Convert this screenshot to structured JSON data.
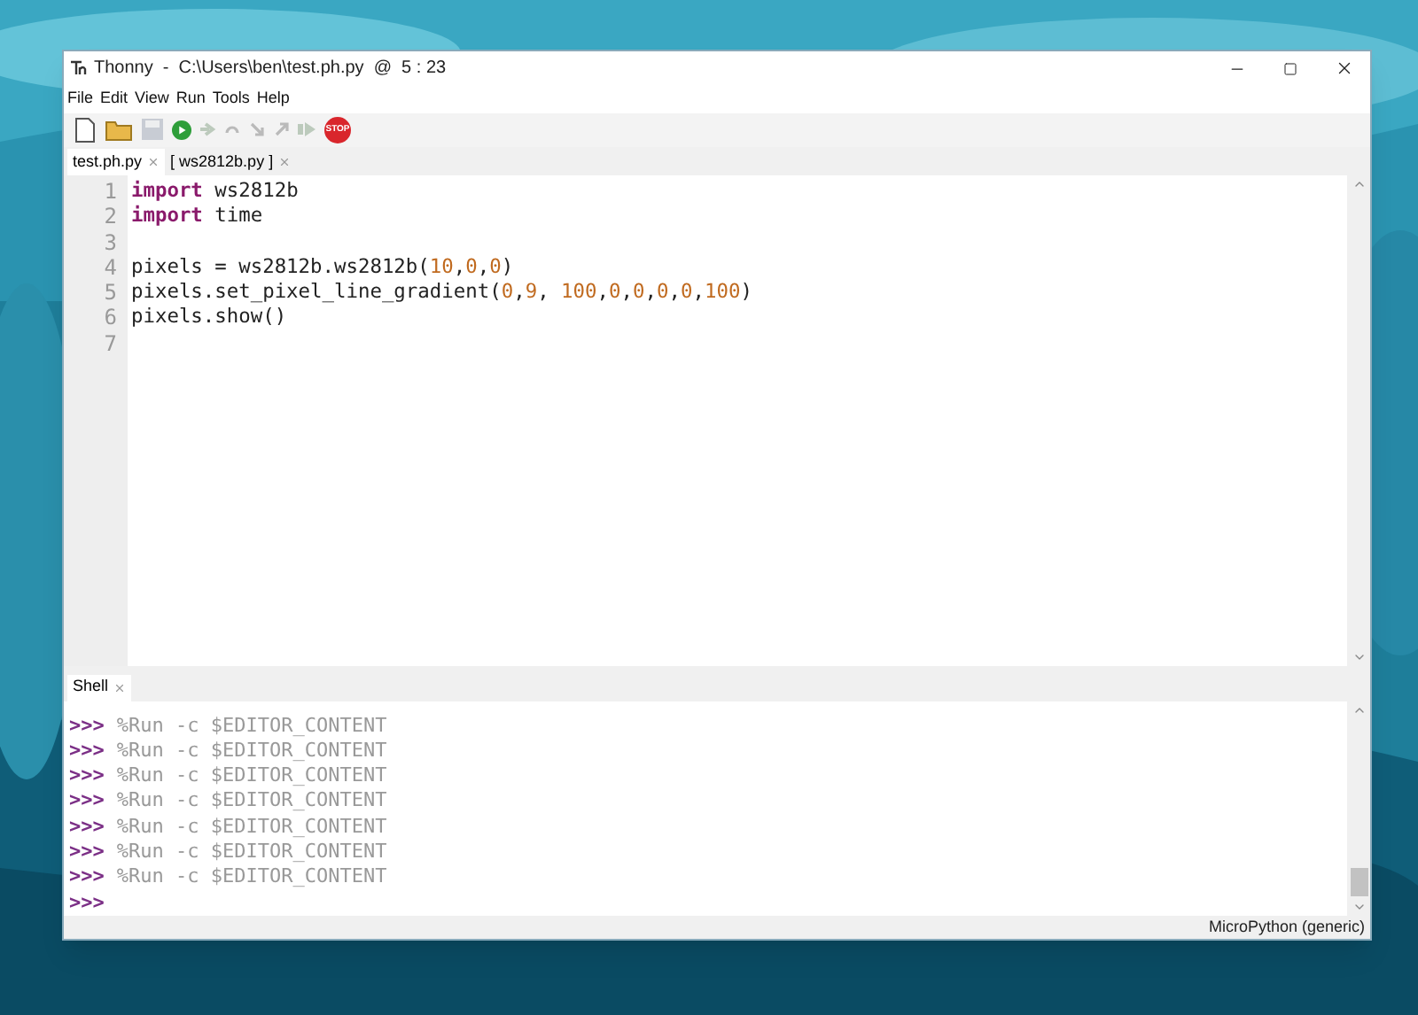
{
  "window": {
    "title": "Thonny  -  C:\\Users\\ben\\test.ph.py  @  5 : 23"
  },
  "menu": [
    "File",
    "Edit",
    "View",
    "Run",
    "Tools",
    "Help"
  ],
  "toolbar": [
    {
      "kind": "new",
      "disabled": false
    },
    {
      "kind": "open",
      "disabled": false
    },
    {
      "kind": "save",
      "disabled": true
    },
    {
      "kind": "run",
      "disabled": false
    },
    {
      "kind": "debug",
      "disabled": true
    },
    {
      "kind": "step-over",
      "disabled": true
    },
    {
      "kind": "step-into",
      "disabled": true
    },
    {
      "kind": "step-out",
      "disabled": true
    },
    {
      "kind": "resume",
      "disabled": true
    },
    {
      "kind": "stop",
      "disabled": false,
      "label": "STOP"
    }
  ],
  "editor_tabs": [
    {
      "label": "test.ph.py",
      "selected": true
    },
    {
      "label": "[ ws2812b.py ]",
      "selected": false
    }
  ],
  "editor": {
    "lines": [
      {
        "number": "1",
        "tokens": [
          {
            "kind": "keyword",
            "text": "import"
          },
          {
            "kind": "plain",
            "text": " ws2812b"
          }
        ]
      },
      {
        "number": "2",
        "tokens": [
          {
            "kind": "keyword",
            "text": "import"
          },
          {
            "kind": "plain",
            "text": " time"
          }
        ]
      },
      {
        "number": "3"
      },
      {
        "number": "4",
        "tokens": [
          {
            "kind": "plain",
            "text": "pixels = ws2812b.ws2812b("
          },
          {
            "kind": "number",
            "text": "10"
          },
          {
            "kind": "plain",
            "text": ","
          },
          {
            "kind": "number",
            "text": "0"
          },
          {
            "kind": "plain",
            "text": ","
          },
          {
            "kind": "number",
            "text": "0"
          },
          {
            "kind": "plain",
            "text": ")"
          }
        ]
      },
      {
        "number": "5",
        "tokens": [
          {
            "kind": "plain",
            "text": "pixels.set_pixel_line_gradient("
          },
          {
            "kind": "number",
            "text": "0"
          },
          {
            "kind": "plain",
            "text": ","
          },
          {
            "kind": "number",
            "text": "9"
          },
          {
            "kind": "plain",
            "text": ", "
          },
          {
            "kind": "number",
            "text": "100"
          },
          {
            "kind": "plain",
            "text": ","
          },
          {
            "kind": "number",
            "text": "0"
          },
          {
            "kind": "plain",
            "text": ","
          },
          {
            "kind": "number",
            "text": "0"
          },
          {
            "kind": "plain",
            "text": ","
          },
          {
            "kind": "number",
            "text": "0"
          },
          {
            "kind": "plain",
            "text": ","
          },
          {
            "kind": "number",
            "text": "0"
          },
          {
            "kind": "plain",
            "text": ","
          },
          {
            "kind": "number",
            "text": "100"
          },
          {
            "kind": "plain",
            "text": ")"
          }
        ]
      },
      {
        "number": "6",
        "tokens": [
          {
            "kind": "plain",
            "text": "pixels.show()"
          }
        ]
      },
      {
        "number": "7"
      }
    ]
  },
  "shell_tab": {
    "label": "Shell",
    "selected": true
  },
  "shell": {
    "lines": [
      {
        "prompt": ">>>",
        "command": "%Run -c $EDITOR_CONTENT"
      },
      {
        "prompt": ">>>",
        "command": "%Run -c $EDITOR_CONTENT"
      },
      {
        "prompt": ">>>",
        "command": "%Run -c $EDITOR_CONTENT"
      },
      {
        "prompt": ">>>",
        "command": "%Run -c $EDITOR_CONTENT"
      },
      {
        "prompt": ">>>",
        "command": "%Run -c $EDITOR_CONTENT"
      },
      {
        "prompt": ">>>",
        "command": "%Run -c $EDITOR_CONTENT"
      },
      {
        "prompt": ">>>",
        "command": "%Run -c $EDITOR_CONTENT"
      },
      {
        "prompt": ">>>"
      }
    ]
  },
  "status_bar": {
    "interpreter": "MicroPython (generic)"
  }
}
